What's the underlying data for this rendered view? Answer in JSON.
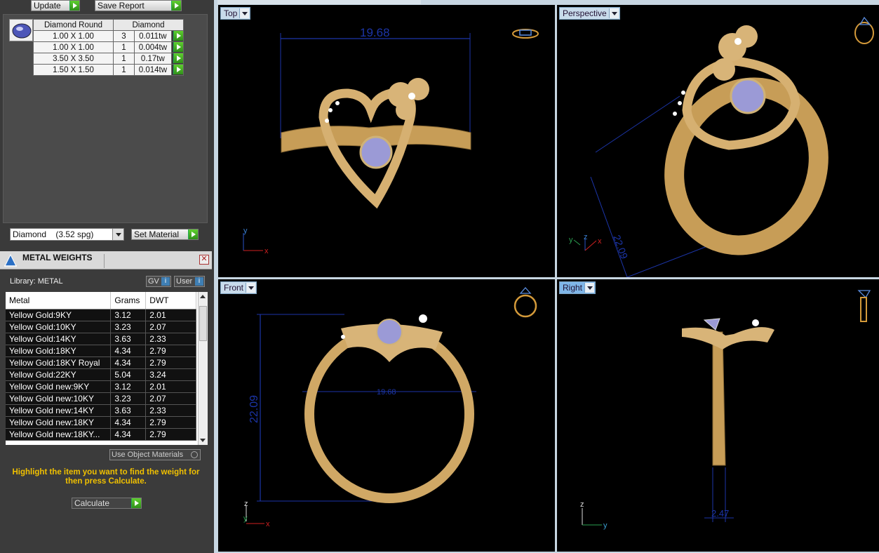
{
  "toolbar": {
    "update_label": "Update",
    "save_report_label": "Save Report"
  },
  "diamond_table": {
    "headers": [
      "Diamond Round",
      "Diamond"
    ],
    "rows": [
      {
        "size": "1.00 X 1.00",
        "count": "3",
        "weight": "0.011tw"
      },
      {
        "size": "1.00 X 1.00",
        "count": "1",
        "weight": "0.004tw"
      },
      {
        "size": "3.50 X 3.50",
        "count": "1",
        "weight": "0.17tw"
      },
      {
        "size": "1.50 X 1.50",
        "count": "1",
        "weight": "0.014tw"
      }
    ]
  },
  "material": {
    "selected": "Diamond    (3.52 spg)",
    "set_label": "Set Material"
  },
  "metal_weights": {
    "title": "METAL WEIGHTS",
    "library_label": "Library: METAL",
    "gv_label": "GV",
    "user_label": "User",
    "toggle_info": "i",
    "headers": [
      "Metal",
      "Grams",
      "DWT"
    ],
    "rows": [
      {
        "metal": "Yellow Gold:9KY",
        "grams": "3.12",
        "dwt": "2.01"
      },
      {
        "metal": "Yellow Gold:10KY",
        "grams": "3.23",
        "dwt": "2.07"
      },
      {
        "metal": "Yellow Gold:14KY",
        "grams": "3.63",
        "dwt": "2.33"
      },
      {
        "metal": "Yellow Gold:18KY",
        "grams": "4.34",
        "dwt": "2.79"
      },
      {
        "metal": "Yellow Gold:18KY Royal",
        "grams": "4.34",
        "dwt": "2.79"
      },
      {
        "metal": "Yellow Gold:22KY",
        "grams": "5.04",
        "dwt": "3.24"
      },
      {
        "metal": "Yellow Gold new:9KY",
        "grams": "3.12",
        "dwt": "2.01"
      },
      {
        "metal": "Yellow Gold new:10KY",
        "grams": "3.23",
        "dwt": "2.07"
      },
      {
        "metal": "Yellow Gold new:14KY",
        "grams": "3.63",
        "dwt": "2.33"
      },
      {
        "metal": "Yellow Gold new:18KY",
        "grams": "4.34",
        "dwt": "2.79"
      },
      {
        "metal": "Yellow Gold new:18KY...",
        "grams": "4.34",
        "dwt": "2.79"
      }
    ],
    "use_object_materials": "Use Object Materials",
    "hint": "Highlight the item you want to find the weight for then press Calculate.",
    "calculate_label": "Calculate"
  },
  "viewports": {
    "top": {
      "label": "Top",
      "dim": "19.68"
    },
    "perspective": {
      "label": "Perspective",
      "dim": "22.09"
    },
    "front": {
      "label": "Front",
      "dim_v": "22.09",
      "dim_h": "19.68"
    },
    "right": {
      "label": "Right",
      "dim": "2.47"
    }
  },
  "axes": {
    "x": "x",
    "y": "y",
    "z": "z"
  },
  "colors": {
    "gold": "#d6b071",
    "gem": "#9b9ad6",
    "dim_line": "#1c35a8",
    "accent_go": "#3fa424",
    "hint": "#f0c000"
  }
}
